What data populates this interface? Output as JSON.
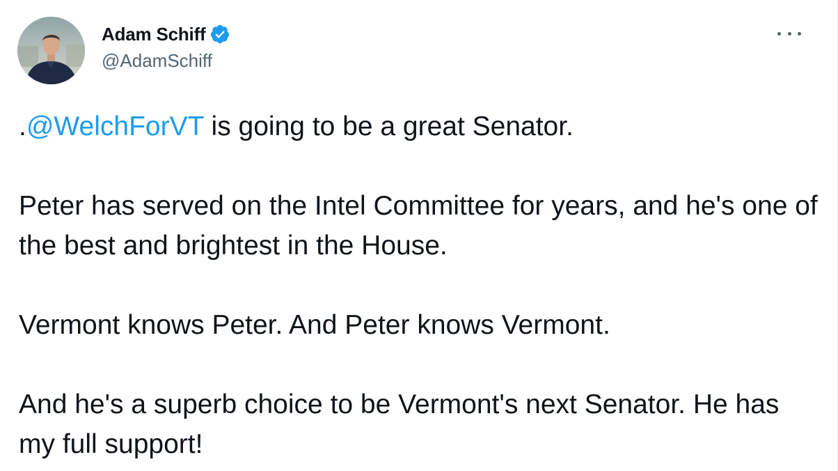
{
  "author": {
    "display_name": "Adam Schiff",
    "handle": "@AdamSchiff",
    "verified": true,
    "avatar_icon": "profile-photo"
  },
  "menu": {
    "icon": "more-horizontal-icon"
  },
  "tweet": {
    "line1_prefix": ".",
    "mention": "@WelchForVT",
    "line1_suffix": " is going to be a great Senator.",
    "paragraph2": "Peter has served on the Intel Committee for years, and he's one of the best and brightest in the House.",
    "paragraph3": "Vermont knows Peter. And Peter knows Vermont.",
    "paragraph4": "And he's a superb choice to be Vermont's next Senator. He has my full support!"
  },
  "colors": {
    "link": "#1d9bf0",
    "verified_badge": "#1d9bf0",
    "secondary_text": "#536471",
    "primary_text": "#0f1419"
  }
}
